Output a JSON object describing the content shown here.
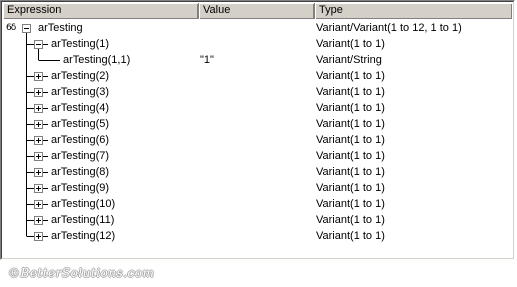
{
  "columns": {
    "expression": "Expression",
    "value": "Value",
    "type": "Type"
  },
  "watch_icon": "6δ",
  "rows": [
    {
      "expression": "arTesting",
      "value": "",
      "type": "Variant/Variant(1 to 12, 1 to 1)",
      "level": 0,
      "state": "expanded"
    },
    {
      "expression": "arTesting(1)",
      "value": "",
      "type": "Variant(1 to 1)",
      "level": 1,
      "state": "expanded"
    },
    {
      "expression": "arTesting(1,1)",
      "value": "\"1\"",
      "type": "Variant/String",
      "level": 2,
      "state": "leaf"
    },
    {
      "expression": "arTesting(2)",
      "value": "",
      "type": "Variant(1 to 1)",
      "level": 1,
      "state": "collapsed"
    },
    {
      "expression": "arTesting(3)",
      "value": "",
      "type": "Variant(1 to 1)",
      "level": 1,
      "state": "collapsed"
    },
    {
      "expression": "arTesting(4)",
      "value": "",
      "type": "Variant(1 to 1)",
      "level": 1,
      "state": "collapsed"
    },
    {
      "expression": "arTesting(5)",
      "value": "",
      "type": "Variant(1 to 1)",
      "level": 1,
      "state": "collapsed"
    },
    {
      "expression": "arTesting(6)",
      "value": "",
      "type": "Variant(1 to 1)",
      "level": 1,
      "state": "collapsed"
    },
    {
      "expression": "arTesting(7)",
      "value": "",
      "type": "Variant(1 to 1)",
      "level": 1,
      "state": "collapsed"
    },
    {
      "expression": "arTesting(8)",
      "value": "",
      "type": "Variant(1 to 1)",
      "level": 1,
      "state": "collapsed"
    },
    {
      "expression": "arTesting(9)",
      "value": "",
      "type": "Variant(1 to 1)",
      "level": 1,
      "state": "collapsed"
    },
    {
      "expression": "arTesting(10)",
      "value": "",
      "type": "Variant(1 to 1)",
      "level": 1,
      "state": "collapsed"
    },
    {
      "expression": "arTesting(11)",
      "value": "",
      "type": "Variant(1 to 1)",
      "level": 1,
      "state": "collapsed"
    },
    {
      "expression": "arTesting(12)",
      "value": "",
      "type": "Variant(1 to 1)",
      "level": 1,
      "state": "collapsed"
    }
  ],
  "watermark": "©BetterSolutions.com"
}
